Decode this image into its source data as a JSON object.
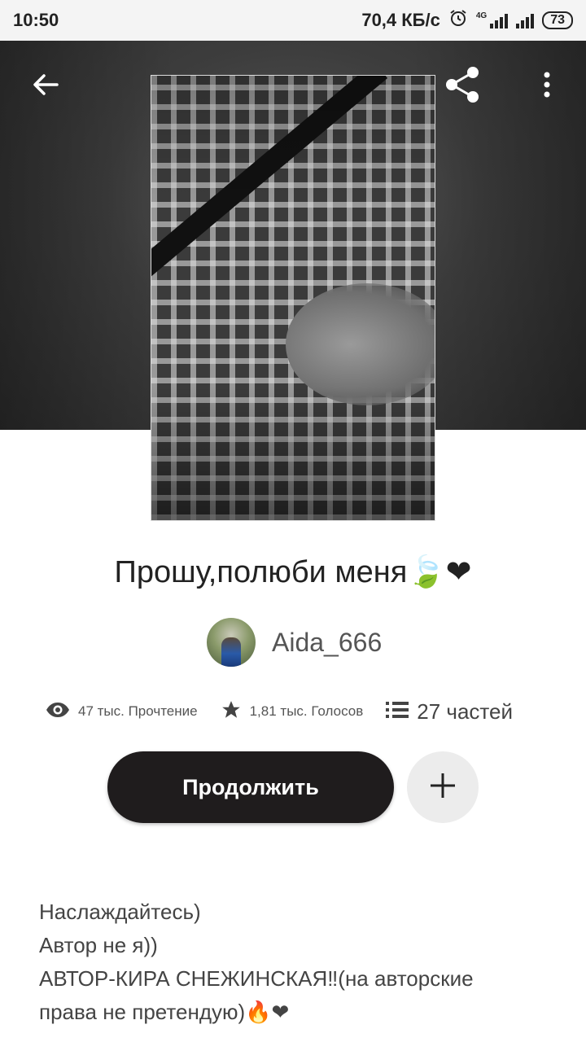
{
  "status_bar": {
    "time": "10:50",
    "network_speed": "70,4 КБ/с",
    "network_type": "4G",
    "battery": "73"
  },
  "header": {
    "back_icon": "arrow-left-icon",
    "share_icon": "share-icon",
    "menu_icon": "more-vertical-icon"
  },
  "story": {
    "title": "Прошу,полюби меня🍃❤",
    "author": "Aida_666",
    "reads": "47 тыс. Прочтение",
    "votes": "1,81 тыс. Голосов",
    "parts": "27 частей"
  },
  "actions": {
    "continue_label": "Продолжить",
    "add_icon": "plus-icon"
  },
  "description": [
    "Наслаждайтесь)",
    "Автор не я))",
    "АВТОР-КИРА СНЕЖИНСКАЯ‼(на авторские",
    "права не претендую)🔥❤"
  ],
  "colors": {
    "primary_button": "#1f1c1d",
    "secondary_button": "#ececec",
    "heart": "#e85a8a"
  }
}
